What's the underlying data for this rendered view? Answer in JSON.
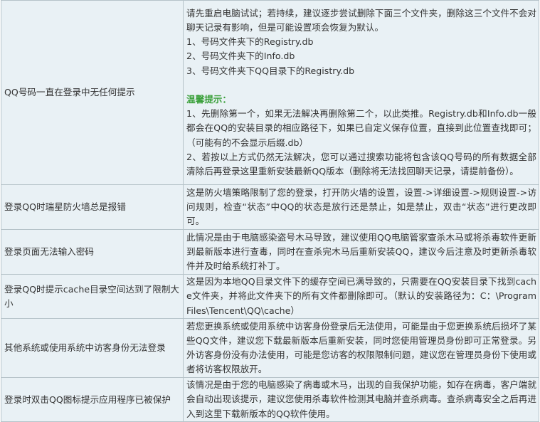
{
  "faq": [
    {
      "question": "QQ号码一直在登录中无任何提示",
      "answer": [
        "请先重启电脑试试；若持续，建议逐步尝试删除下面三个文件夹，删除这三个文件不会对聊天记录有影响，但是可能设置项会恢复为默认。",
        "1、号码文件夹下的Registry.db",
        "2、号码文件夹下的Info.db",
        "3、号码文件夹下QQ目录下的Registry.db"
      ],
      "tip_heading": "温馨提示：",
      "tips": [
        "1、先删除第一个，如果无法解决再删除第二个，以此类推。Registry.db和Info.db一般都会在QQ的安装目录的相应路径下，如果已自定义保存位置，直接到此位置查找即可；（可能有的不会显示后缀.db）",
        "2、若按以上方式仍然无法解决，您可以通过搜索功能将包含该QQ号码的所有数据全部清除后再登录这里重新安装最新QQ版本（删除将无法找回聊天记录，请提前备份）。"
      ]
    },
    {
      "question": "登录QQ时瑞星防火墙总是报错",
      "answer": [
        "这是防火墙策略限制了您的登录，打开防火墙的设置，设置->详细设置->规则设置->访问规则，检查“状态”中QQ的状态是放行还是禁止，如是禁止，双击“状态”进行更改即可。"
      ]
    },
    {
      "question": "登录页面无法输入密码",
      "answer": [
        "此情况是由于电脑感染盗号木马导致，建议使用QQ电脑管家查杀木马或将杀毒软件更新到最新版本进行查毒，同时在查杀完木马后重新安装QQ，建议今后注意及时更新杀毒软件并及时给系统打补丁。"
      ]
    },
    {
      "question": "登录QQ时提示cache目录空间达到了限制大小",
      "answer": [
        "这是因为本地QQ目录文件下的缓存空间已满导致的，只需要在QQ安装目录下找到cache文件夹，并将此文件夹下的所有文件都删除即可。（默认的安装路径为：C：\\Program Files\\Tencent\\QQ\\cache）"
      ]
    },
    {
      "question": "其他系统或使用系统中访客身份无法登录",
      "answer": [
        "若您更换系统或使用系统中访客身份登录后无法使用，可能是由于您更换系统后损坏了某些QQ文件，建议您下载最新版本后重新安装，同时您使用管理员身份即可正常登录。另外访客身份没有办法使用，可能是您访客的权限限制问题，建议您在管理员身份下使用或者将访客权限放开。"
      ]
    },
    {
      "question": "登录时双击QQ图标提示应用程序已被保护",
      "answer": [
        "该情况是由于您的电脑感染了病毒或木马，出现的自我保护功能，如存在病毒，客户端就会自动出现该提示，建议您使用杀毒软件检测其电脑并查杀病毒。查杀病毒安全之后再进入到这里下载新版本的QQ软件使用。"
      ]
    }
  ]
}
